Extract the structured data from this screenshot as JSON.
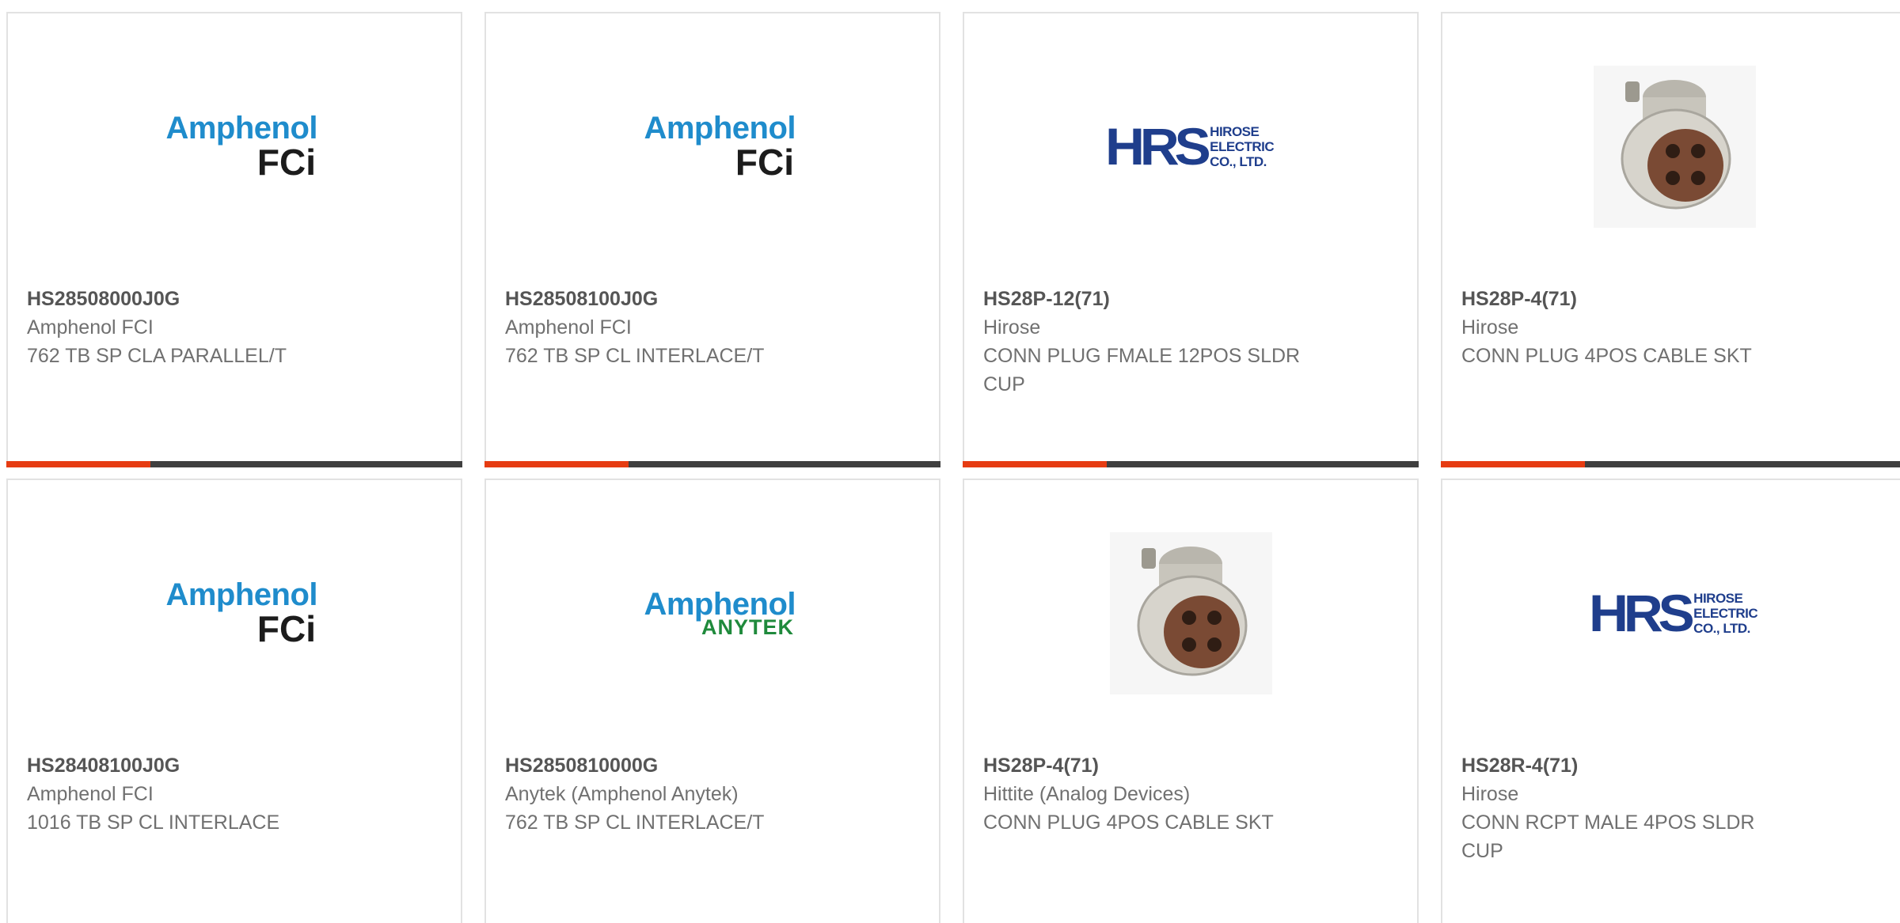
{
  "products": [
    {
      "part_number": "HS28508000J0G",
      "manufacturer": "Amphenol FCI",
      "description": "762 TB SP CLA PARALLEL/T",
      "logo": {
        "type": "amphenol-fci",
        "brand": "Amphenol",
        "sub": "FCi"
      }
    },
    {
      "part_number": "HS28508100J0G",
      "manufacturer": "Amphenol FCI",
      "description": "762 TB SP CL INTERLACE/T",
      "logo": {
        "type": "amphenol-fci",
        "brand": "Amphenol",
        "sub": "FCi"
      }
    },
    {
      "part_number": "HS28P-12(71)",
      "manufacturer": "Hirose",
      "description": "CONN PLUG FMALE 12POS SLDR CUP",
      "logo": {
        "type": "hrs",
        "mark": "HRS",
        "line1": "HIROSE",
        "line2": "ELECTRIC",
        "line3": "CO., LTD."
      }
    },
    {
      "part_number": "HS28P-4(71)",
      "manufacturer": "Hirose",
      "description": "CONN PLUG 4POS CABLE SKT",
      "logo": {
        "type": "connector-photo"
      }
    },
    {
      "part_number": "HS28408100J0G",
      "manufacturer": "Amphenol FCI",
      "description": "1016 TB SP CL INTERLACE",
      "logo": {
        "type": "amphenol-fci",
        "brand": "Amphenol",
        "sub": "FCi"
      }
    },
    {
      "part_number": "HS2850810000G",
      "manufacturer": "Anytek (Amphenol Anytek)",
      "description": "762 TB SP CL INTERLACE/T",
      "logo": {
        "type": "amphenol-anytek",
        "brand": "Amphenol",
        "sub": "ANYTEK"
      }
    },
    {
      "part_number": "HS28P-4(71)",
      "manufacturer": "Hittite (Analog Devices)",
      "description": "CONN PLUG 4POS CABLE SKT",
      "logo": {
        "type": "connector-photo"
      }
    },
    {
      "part_number": "HS28R-4(71)",
      "manufacturer": "Hirose",
      "description": "CONN RCPT MALE 4POS SLDR CUP",
      "logo": {
        "type": "hrs",
        "mark": "HRS",
        "line1": "HIROSE",
        "line2": "ELECTRIC",
        "line3": "CO., LTD."
      }
    }
  ],
  "colors": {
    "accent": "#e63c12",
    "bar": "#3f3f3f",
    "amphenol_blue": "#1f8ccc",
    "hirose_blue": "#1f3e8c",
    "anytek_green": "#1f8a3c"
  }
}
